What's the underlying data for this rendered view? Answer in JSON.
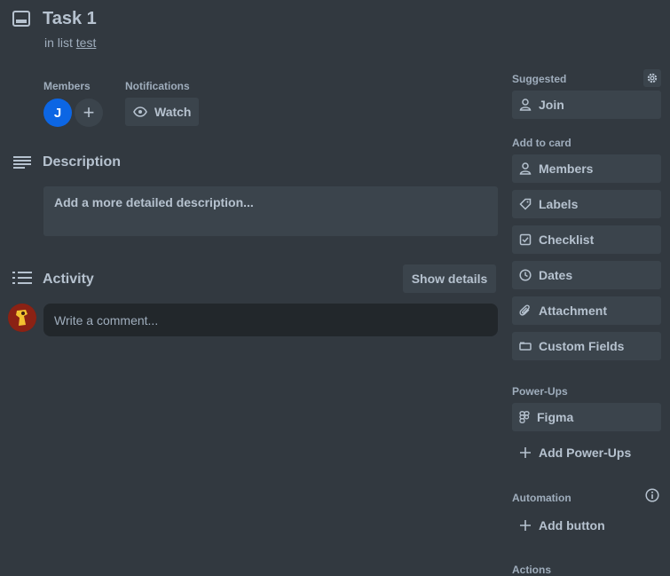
{
  "card": {
    "title": "Task 1",
    "in_list_prefix": "in list",
    "list_name": "test"
  },
  "members": {
    "label": "Members",
    "avatar_initial": "J",
    "add_symbol": "+"
  },
  "notifications": {
    "label": "Notifications",
    "watch_label": "Watch"
  },
  "description": {
    "heading": "Description",
    "placeholder": "Add a more detailed description..."
  },
  "activity": {
    "heading": "Activity",
    "show_details_label": "Show details",
    "comment_placeholder": "Write a comment..."
  },
  "sidebar": {
    "suggested": {
      "label": "Suggested",
      "join_label": "Join"
    },
    "add_to_card": {
      "label": "Add to card",
      "items": [
        {
          "label": "Members",
          "icon": "person-icon"
        },
        {
          "label": "Labels",
          "icon": "tag-icon"
        },
        {
          "label": "Checklist",
          "icon": "checklist-icon"
        },
        {
          "label": "Dates",
          "icon": "clock-icon"
        },
        {
          "label": "Attachment",
          "icon": "paperclip-icon"
        },
        {
          "label": "Custom Fields",
          "icon": "custom-fields-icon"
        }
      ]
    },
    "power_ups": {
      "label": "Power-Ups",
      "figma_label": "Figma",
      "add_label": "Add Power-Ups"
    },
    "automation": {
      "label": "Automation",
      "add_button_label": "Add button"
    },
    "actions": {
      "label": "Actions"
    }
  },
  "colors": {
    "background": "#323940",
    "button": "#3b444c",
    "input": "#22272b",
    "text": "#b6c2cf",
    "muted_text": "#9fadbc",
    "avatar_blue": "#0c66e4"
  }
}
